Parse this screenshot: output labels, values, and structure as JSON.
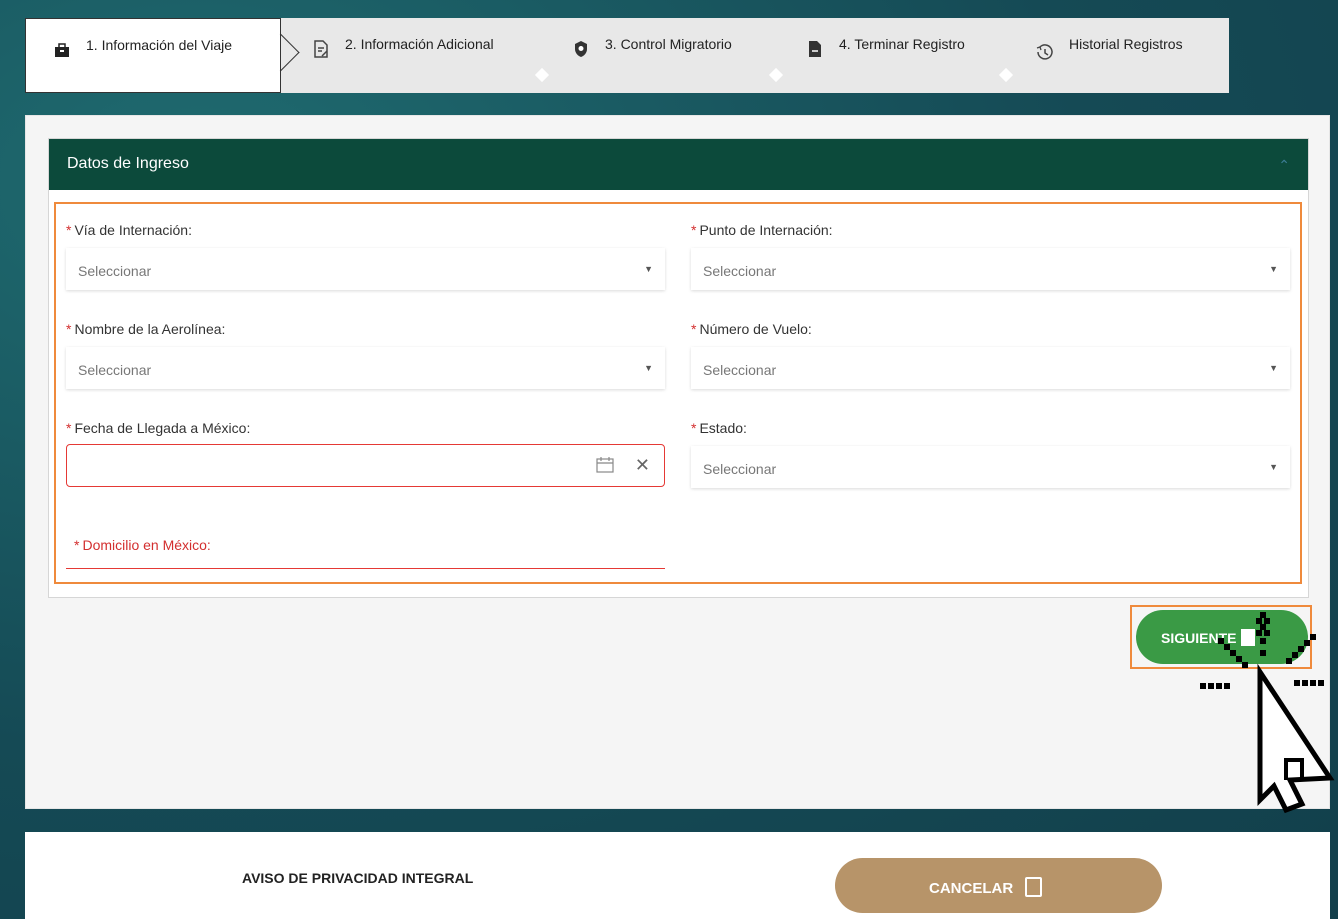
{
  "stepper": {
    "steps": [
      {
        "label": "1. Información del Viaje",
        "icon": "briefcase-icon",
        "active": true
      },
      {
        "label": "2. Información Adicional",
        "icon": "document-edit-icon",
        "active": false
      },
      {
        "label": "3. Control Migratorio",
        "icon": "shield-icon",
        "active": false
      },
      {
        "label": "4. Terminar Registro",
        "icon": "file-icon",
        "active": false
      },
      {
        "label": "Historial Registros",
        "icon": "history-icon",
        "active": false
      }
    ]
  },
  "card": {
    "title": "Datos de Ingreso",
    "collapse_icon": "chevron-up-icon"
  },
  "form": {
    "required_mark": "*",
    "via": {
      "label": "Vía de Internación:",
      "value": "Seleccionar"
    },
    "punto": {
      "label": "Punto de Internación:",
      "value": "Seleccionar"
    },
    "aerolinea": {
      "label": "Nombre de la Aerolínea:",
      "value": "Seleccionar"
    },
    "vuelo": {
      "label": "Número de Vuelo:",
      "value": "Seleccionar"
    },
    "fecha": {
      "label": "Fecha de Llegada a México:",
      "value": ""
    },
    "estado": {
      "label": "Estado:",
      "value": "Seleccionar"
    },
    "domicilio": {
      "label": "Domicilio en México:"
    }
  },
  "actions": {
    "next_label": "SIGUIENTE",
    "cancel_label": "CANCELAR"
  },
  "footer": {
    "privacy_label": "AVISO DE PRIVACIDAD INTEGRAL"
  },
  "colors": {
    "header_green": "#0c4a3b",
    "next_green": "#3a9a45",
    "cancel_gold": "#b79469",
    "highlight_orange": "#ef8a3c",
    "error_red": "#e53935"
  }
}
